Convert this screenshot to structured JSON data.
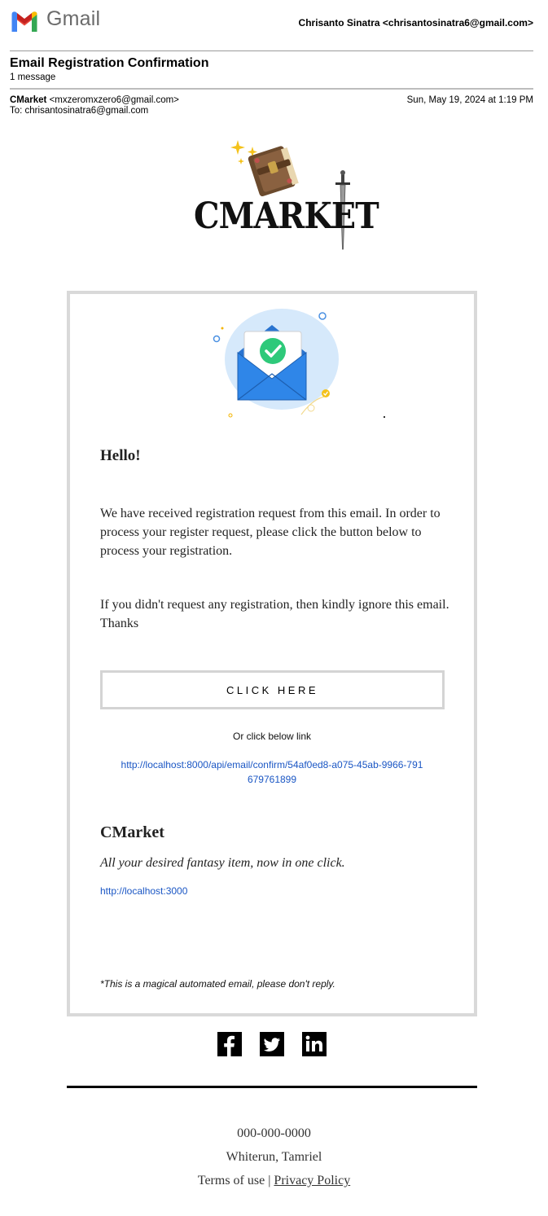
{
  "app": {
    "name": "Gmail"
  },
  "account": {
    "label": "Chrisanto Sinatra <chrisantosinatra6@gmail.com>"
  },
  "thread": {
    "subject": "Email Registration Confirmation",
    "count": "1 message"
  },
  "message": {
    "sender_name": "CMarket",
    "sender_email": "<mxzeromxzero6@gmail.com>",
    "date": "Sun, May 19, 2024 at 1:19 PM",
    "to": "To: chrisantosinatra6@gmail.com"
  },
  "brand": {
    "logo_text": "CMARKET",
    "logo_icon": "book-and-sword-logo"
  },
  "email": {
    "greeting": "Hello!",
    "paragraph1": "We have received registration request from this email. In order to process your register request, please click the button below to process your registration.",
    "paragraph2": "If you didn't request any registration, then kindly ignore this email. Thanks",
    "button_label": "CLICK HERE",
    "alt_text": "Or click below link",
    "confirm_link": "http://localhost:8000/api/email/confirm/54af0ed8-a075-45ab-9966-791679761899",
    "signature_name": "CMarket",
    "tagline": "All your desired fantasy item, now in one click.",
    "site_link": "http://localhost:3000",
    "automated_note": "*This is a magical automated email, please don't reply.",
    "illustration_icon": "envelope-check-icon"
  },
  "social": [
    {
      "icon": "facebook-icon"
    },
    {
      "icon": "twitter-icon"
    },
    {
      "icon": "linkedin-icon"
    }
  ],
  "footer": {
    "phone": "000-000-0000",
    "address": "Whiterun, Tamriel",
    "terms": "Terms of use",
    "separator": "|",
    "privacy": "Privacy Policy"
  },
  "colors": {
    "link": "#1a56c4",
    "gmail_red": "#ea4335",
    "gmail_blue": "#4285f4",
    "gmail_green": "#34a853",
    "gmail_yellow": "#fbbc04",
    "envelope_blue": "#2f86e8",
    "check_green": "#2ec97a"
  }
}
